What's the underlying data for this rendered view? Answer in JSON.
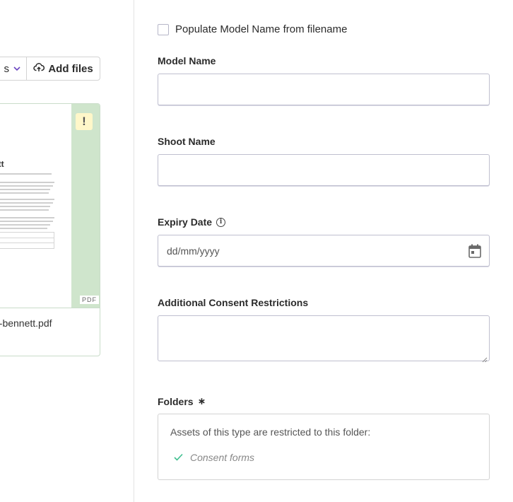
{
  "left": {
    "dropdown_label": "s",
    "add_files_label": "Add files",
    "card": {
      "doc_title": "ett",
      "file_type": "PDF",
      "warning": "!",
      "filename": "a-bennett.pdf"
    }
  },
  "form": {
    "populate_checkbox_label": "Populate Model Name from filename",
    "model_name": {
      "label": "Model Name",
      "value": ""
    },
    "shoot_name": {
      "label": "Shoot Name",
      "value": ""
    },
    "expiry_date": {
      "label": "Expiry Date",
      "placeholder": "dd/mm/yyyy",
      "info": "i"
    },
    "consent_restrictions": {
      "label": "Additional Consent Restrictions",
      "value": ""
    },
    "folders": {
      "label": "Folders",
      "required_mark": "∗",
      "note": "Assets of this type are restricted to this folder:",
      "items": [
        "Consent forms"
      ]
    }
  },
  "colors": {
    "accent": "#6b46c1",
    "card_strip": "#cfe5cc",
    "warning_bg": "#fff7c9",
    "check": "#3fbf8f"
  }
}
